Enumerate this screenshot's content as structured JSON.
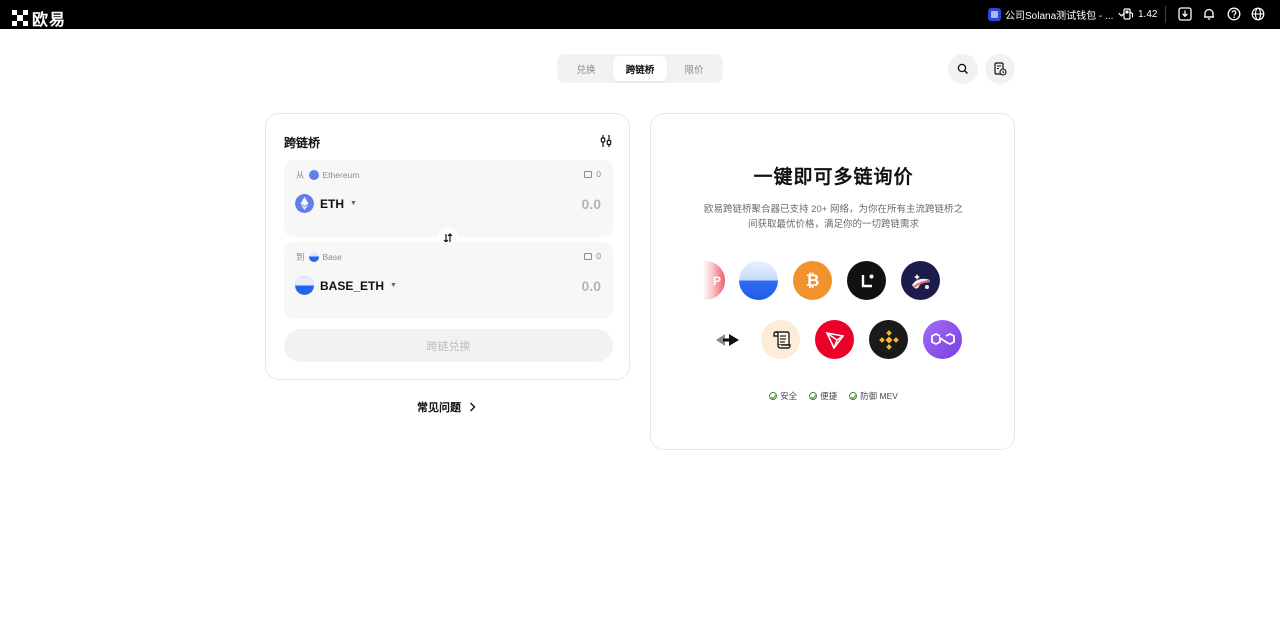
{
  "topbar": {
    "logo_text": "欧易",
    "wallet_name": "公司Solana测试钱包 - ...",
    "gas_value": "1.42"
  },
  "tabs": [
    {
      "label": "兑换",
      "active": false
    },
    {
      "label": "跨链桥",
      "active": true
    },
    {
      "label": "限价",
      "active": false
    }
  ],
  "bridge": {
    "title": "跨链桥",
    "from": {
      "prefix": "从",
      "chain": "Ethereum",
      "balance": "0",
      "token": "ETH",
      "amount": "0.0"
    },
    "to": {
      "prefix": "到",
      "chain": "Base",
      "balance": "0",
      "token": "BASE_ETH",
      "amount": "0.0"
    },
    "submit_label": "跨链兑换"
  },
  "faq_label": "常见问题",
  "promo": {
    "title": "一键即可多链询价",
    "description": "欧易跨链桥聚合器已支持 20+ 网络，为你在所有主流跨链桥之间获取最优价格，满足你的一切跨链需求",
    "features": [
      "安全",
      "便捷",
      "防御 MEV"
    ]
  },
  "colors": {
    "accent": "#000000",
    "eth": "#627eea",
    "btc": "#f2922c",
    "tron": "#eb0029",
    "bnb": "#1a1a1a",
    "polygon": "#8247e5",
    "success": "#4a8a3a"
  },
  "icons": [
    "okx-logo-icon",
    "wallet-icon",
    "gas-icon",
    "download-icon",
    "bell-icon",
    "help-icon",
    "globe-icon",
    "search-icon",
    "history-icon",
    "settings-sliders-icon",
    "swap-arrows-icon",
    "chevron-right-icon"
  ]
}
